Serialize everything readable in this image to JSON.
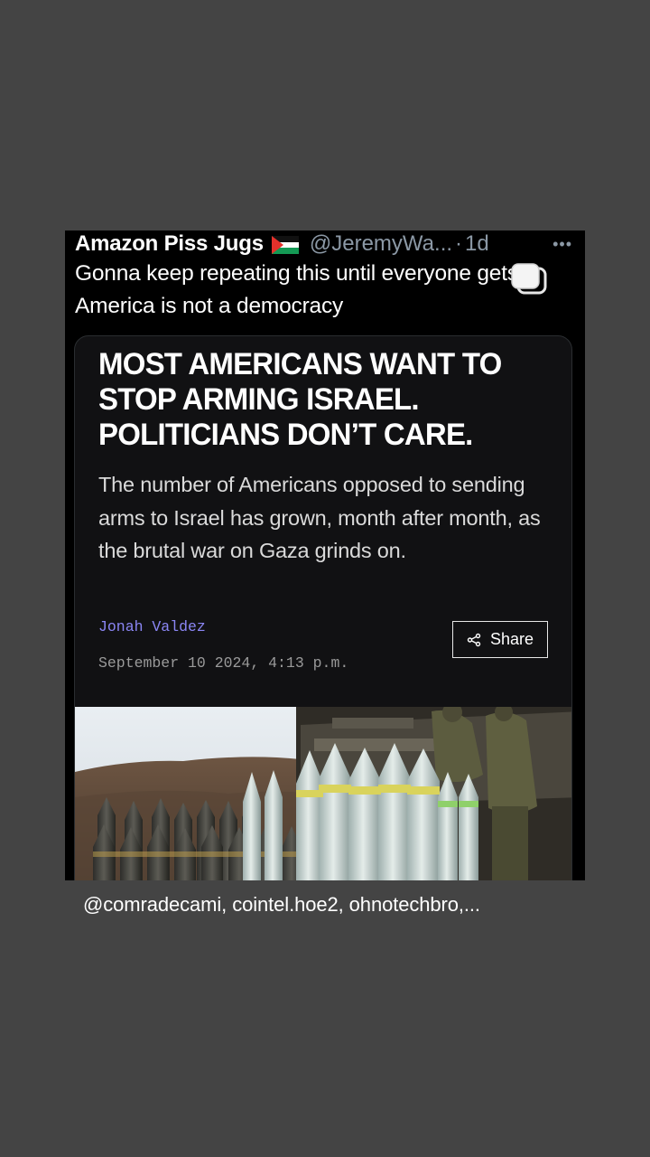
{
  "tweet": {
    "author_name": "Amazon Piss Jugs",
    "flag_icon": "palestine-flag-icon",
    "handle": "@JeremyWa...",
    "separator": "·",
    "time": "1d",
    "more_label": "•••",
    "text": "Gonna keep repeating this until everyone gets it:  America is not a democracy"
  },
  "article": {
    "headline": "MOST AMERICANS WANT TO STOP ARMING ISRAEL. POLITICIANS DON’T CARE.",
    "dek": "The number of Americans opposed to sending arms to Israel has grown, month after month, as the brutal war on Gaza grinds on.",
    "author": "Jonah Valdez",
    "date": "September 10 2024, 4:13 p.m.",
    "share_label": "Share",
    "photo_icon": "artillery-shells-photo"
  },
  "story": {
    "mentions": "@comradecami, cointel.hoe2, ohnotechbro,..."
  },
  "colors": {
    "page_background": "#444444",
    "tweet_background": "#000000",
    "card_background": "#111113",
    "byline": "#8b86f5",
    "muted": "#8b98a5"
  }
}
